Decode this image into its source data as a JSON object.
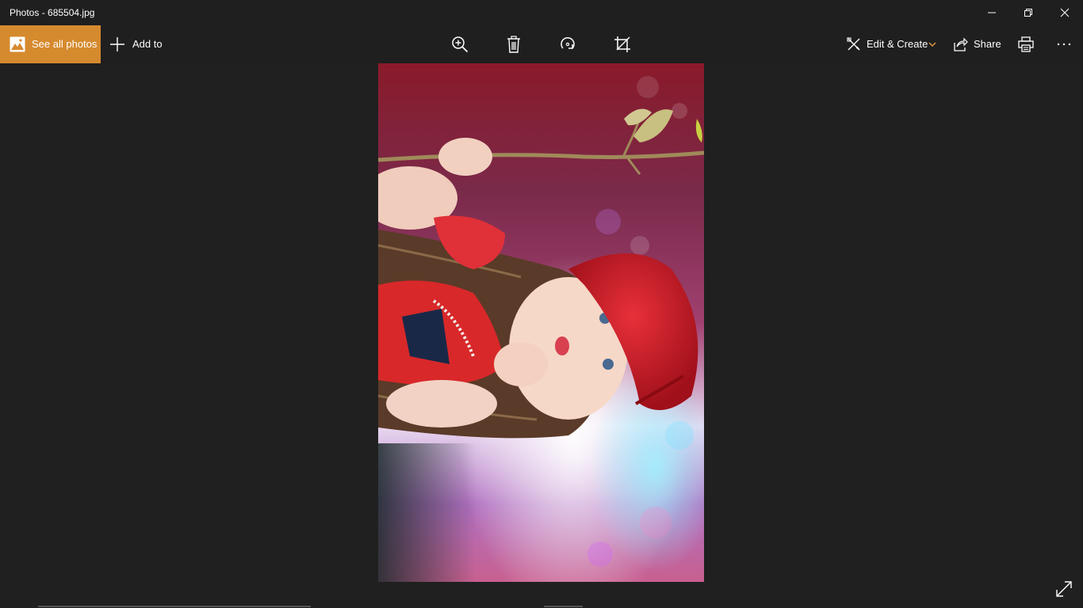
{
  "window": {
    "title": "Photos - 685504.jpg"
  },
  "toolbar": {
    "see_all_label": "See all photos",
    "add_to_label": "Add to",
    "edit_create_label": "Edit & Create",
    "share_label": "Share",
    "more_label": "···"
  },
  "icons": {
    "see_all": "photos-gallery-icon",
    "add_to": "plus-icon",
    "zoom": "zoom-in-icon",
    "delete": "trash-icon",
    "rotate": "rotate-icon",
    "crop": "crop-icon",
    "edit_create": "edit-create-icon",
    "share": "share-icon",
    "print": "print-icon",
    "more": "more-icon",
    "fullscreen": "expand-icon"
  },
  "colors": {
    "accent": "#d68a2e",
    "background": "#202020",
    "toolbar": "#1f1f1f",
    "chevron": "#e0953a"
  }
}
